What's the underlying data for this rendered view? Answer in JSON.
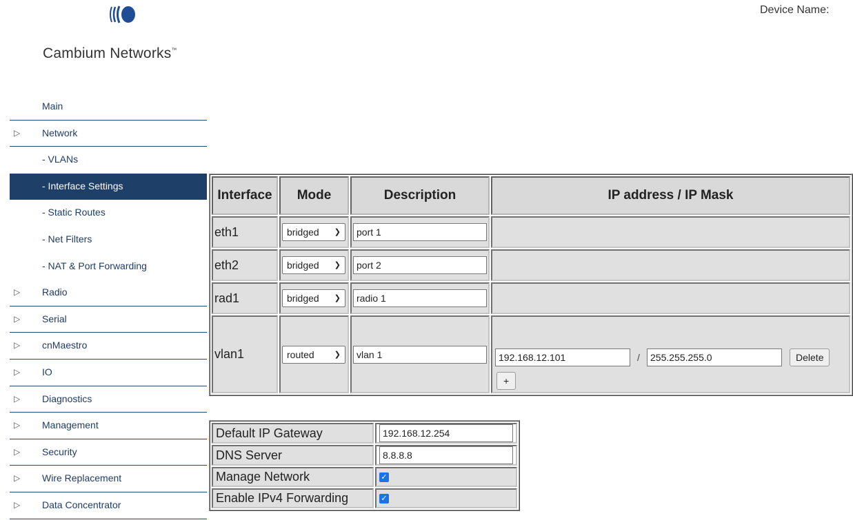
{
  "header": {
    "brand": "Cambium Networks",
    "trademark": "™",
    "device_name_label": "Device Name:"
  },
  "sidebar": {
    "items": [
      {
        "label": "Main",
        "arrow": false,
        "sub": false
      },
      {
        "label": "Network",
        "arrow": true,
        "sub": false
      },
      {
        "label": "-  VLANs",
        "arrow": false,
        "sub": true
      },
      {
        "label": "-  Interface Settings",
        "arrow": false,
        "sub": true,
        "active": true
      },
      {
        "label": "-  Static Routes",
        "arrow": false,
        "sub": true
      },
      {
        "label": "-  Net Filters",
        "arrow": false,
        "sub": true
      },
      {
        "label": "-  NAT & Port Forwarding",
        "arrow": false,
        "sub": true
      },
      {
        "label": "Radio",
        "arrow": true,
        "sub": false
      },
      {
        "label": "Serial",
        "arrow": true,
        "sub": false
      },
      {
        "label": "cnMaestro",
        "arrow": true,
        "sub": false
      },
      {
        "label": "IO",
        "arrow": true,
        "sub": false
      },
      {
        "label": "Diagnostics",
        "arrow": true,
        "sub": false
      },
      {
        "label": "Management",
        "arrow": true,
        "sub": false
      },
      {
        "label": "Security",
        "arrow": true,
        "sub": false
      },
      {
        "label": "Wire Replacement",
        "arrow": true,
        "sub": false
      },
      {
        "label": "Data Concentrator",
        "arrow": true,
        "sub": false
      }
    ],
    "arrow_glyph": "▷"
  },
  "interfaces": {
    "headers": [
      "Interface",
      "Mode",
      "Description",
      "IP address  /  IP Mask"
    ],
    "rows": [
      {
        "name": "eth1",
        "mode": "bridged",
        "description": "port 1"
      },
      {
        "name": "eth2",
        "mode": "bridged",
        "description": "port 2"
      },
      {
        "name": "rad1",
        "mode": "bridged",
        "description": "radio 1"
      },
      {
        "name": "vlan1",
        "mode": "routed",
        "description": "vlan 1",
        "ip": "192.168.12.101",
        "mask": "255.255.255.0",
        "delete_label": "Delete",
        "add_label": "+",
        "separator": "/"
      }
    ]
  },
  "network": {
    "gateway_label": "Default IP Gateway",
    "gateway_value": "192.168.12.254",
    "dns_label": "DNS Server",
    "dns_value": "8.8.8.8",
    "manage_label": "Manage Network",
    "manage_checked": true,
    "forwarding_label": "Enable IPv4 Forwarding",
    "forwarding_checked": true
  },
  "colors": {
    "nav_active_bg": "#1e3f68",
    "nav_text": "#1f3c66",
    "checkbox": "#1a73e8",
    "logo": "#1f4e96"
  },
  "icons": {
    "dropdown": "chevron-down-icon",
    "checkbox": "check-icon"
  }
}
